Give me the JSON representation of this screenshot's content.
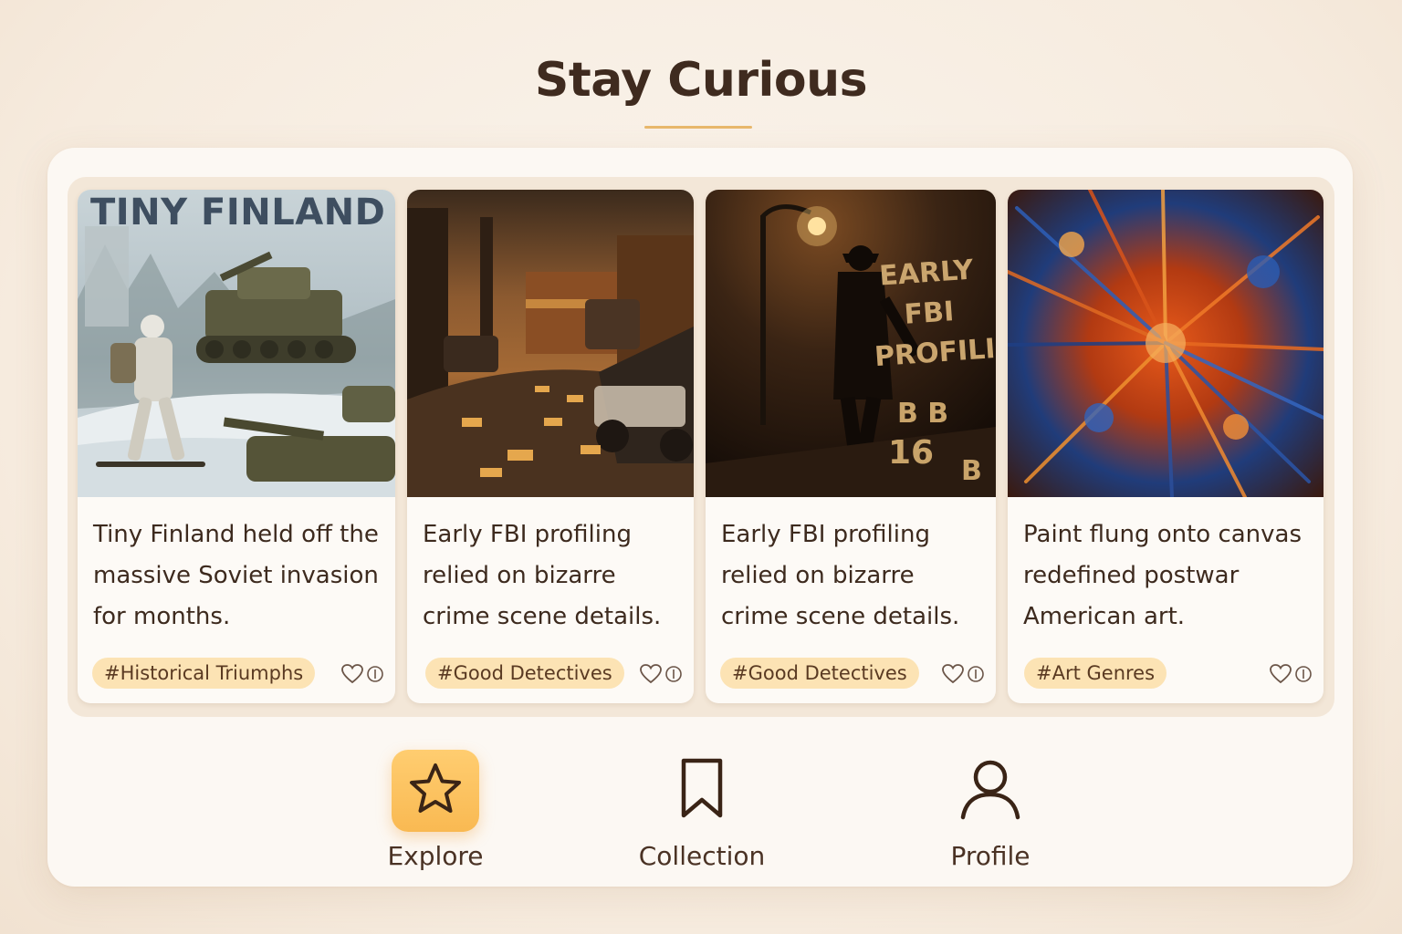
{
  "header": {
    "title": "Stay Curious"
  },
  "cards": [
    {
      "image_caption": "TINY FINLAND",
      "text": "Tiny Finland held off the massive Soviet invasion for months.",
      "tag": "#Historical Triumphs",
      "like_icon": "heart-outline-icon",
      "count_icon": "info-icon"
    },
    {
      "image_caption": "",
      "text": "Early FBI profiling relied on bizarre crime scene details.",
      "tag": "#Good Detectives",
      "like_icon": "heart-outline-icon",
      "count_icon": "info-icon"
    },
    {
      "image_caption": "EARLY FBI PROFILING",
      "text": "Early FBI profiling relied on bizarre crime scene details.",
      "tag": "#Good Detectives",
      "like_icon": "heart-outline-icon",
      "count_icon": "info-icon"
    },
    {
      "image_caption": "",
      "text": "Paint flung onto canvas redefined postwar American art.",
      "tag": "#Art Genres",
      "like_icon": "heart-outline-icon",
      "count_icon": "info-icon"
    }
  ],
  "nav": {
    "items": [
      {
        "label": "Explore",
        "icon": "star-icon",
        "active": true
      },
      {
        "label": "Collection",
        "icon": "bookmark-icon",
        "active": false
      },
      {
        "label": "Profile",
        "icon": "person-icon",
        "active": false
      }
    ]
  },
  "colors": {
    "accent": "#f9b952",
    "tag_background": "#fce3b4",
    "text": "#3d2a1e",
    "background": "#f6ebde"
  }
}
